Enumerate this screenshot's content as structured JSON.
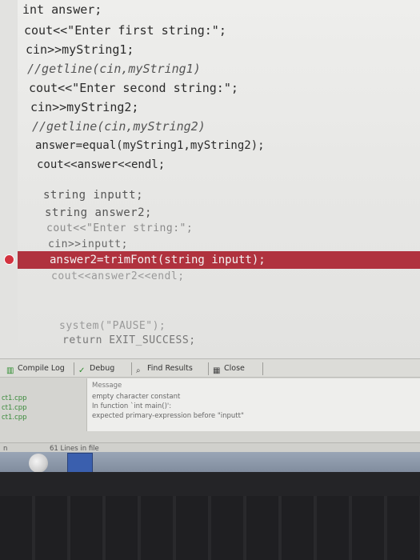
{
  "code": {
    "lines": [
      "int answer;",
      "cout<<\"Enter first string:\";",
      "cin>>myString1;",
      "//getline(cin,myString1)",
      "cout<<\"Enter second string:\";",
      "cin>>myString2;",
      "//getline(cin,myString2)",
      "answer=equal(myString1,myString2);",
      "cout<<answer<<endl;",
      "string inputt;",
      "string answer2;",
      "cout<<\"Enter string:\";",
      "cin>>inputt;",
      "answer2=trimFont(string inputt);",
      "cout<<answer2<<endl;",
      "system(\"PAUSE\");",
      "return EXIT_SUCCESS;"
    ]
  },
  "panel": {
    "tabs": [
      "Compile Log",
      "Debug",
      "Find Results",
      "Close"
    ],
    "files": [
      "ct1.cpp",
      "ct1.cpp",
      "ct1.cpp"
    ],
    "message_header": "Message",
    "messages": [
      "empty character constant",
      "In function `int main()':",
      "expected primary-expression before \"inputt\""
    ],
    "status_left": "n",
    "status_text": "61 Lines in file"
  },
  "colors": {
    "error_line": "#b0323e",
    "string": "#1a3fb8"
  }
}
